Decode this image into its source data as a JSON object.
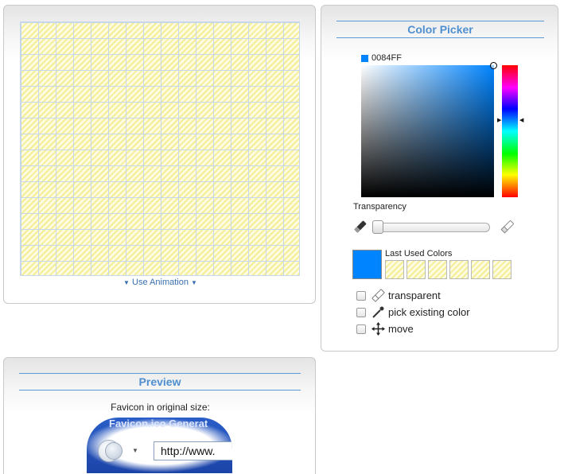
{
  "editor": {
    "animation_toggle": "Use Animation",
    "grid_pattern": "transparent-checker",
    "grid_line_color": "#c8d6ec"
  },
  "color_picker": {
    "title": "Color Picker",
    "hex_value": "0084FF",
    "selected_color": "#0084ff",
    "transparency_label": "Transparency",
    "transparency_value": 0,
    "last_used_label": "Last Used Colors",
    "last_used_colors": [
      "transparent",
      "transparent",
      "transparent",
      "transparent",
      "transparent",
      "transparent"
    ],
    "tools": [
      {
        "label": "transparent",
        "icon": "eraser-icon",
        "checked": false
      },
      {
        "label": "pick existing color",
        "icon": "eyedropper-icon",
        "checked": false
      },
      {
        "label": "move",
        "icon": "move-arrows-icon",
        "checked": false
      }
    ]
  },
  "preview": {
    "title": "Preview",
    "caption": "Favicon in original size:",
    "browser_ghost_title": "Favicon.ico Generat",
    "browser_url": "http://www."
  },
  "colors": {
    "accent": "#4f8fd0",
    "link": "#3a6fb0"
  }
}
